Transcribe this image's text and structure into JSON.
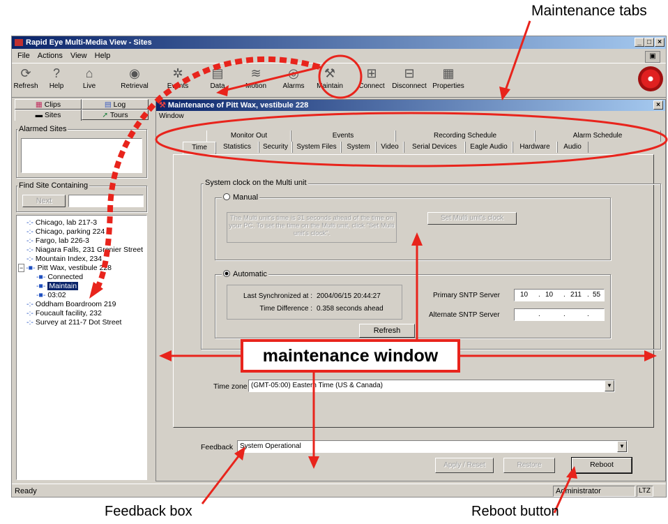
{
  "window": {
    "title": "Rapid Eye Multi-Media View - Sites",
    "controls": [
      "_",
      "□",
      "×"
    ]
  },
  "menu": {
    "items": [
      "File",
      "Actions",
      "View",
      "Help"
    ]
  },
  "toolbar": {
    "buttons": [
      {
        "label": "Refresh",
        "icon": "refresh-icon"
      },
      {
        "label": "Help",
        "icon": "help-icon"
      },
      {
        "label": "Live",
        "icon": "live-camera-icon"
      },
      {
        "label": "Retrieval",
        "icon": "retrieval-icon"
      },
      {
        "label": "Events",
        "icon": "events-icon"
      },
      {
        "label": "Data",
        "icon": "data-icon"
      },
      {
        "label": "Motion",
        "icon": "motion-icon"
      },
      {
        "label": "Alarms",
        "icon": "alarms-icon"
      },
      {
        "label": "Maintain",
        "icon": "maintain-icon"
      },
      {
        "label": "Connect",
        "icon": "connect-icon"
      },
      {
        "label": "Disconnect",
        "icon": "disconnect-icon"
      },
      {
        "label": "Properties",
        "icon": "properties-icon"
      }
    ]
  },
  "sidebar": {
    "tabs_top": [
      "Clips",
      "Log"
    ],
    "tabs_bottom": [
      "Sites",
      "Tours"
    ],
    "alarmed_label": "Alarmed Sites",
    "find_label": "Find Site Containing",
    "next_label": "Next",
    "tree": [
      "Chicago, lab 217-3",
      "Chicago, parking 224",
      "Fargo, lab 226-3",
      "Niagara Falls, 231 Grenier Street",
      "Mountain Index, 234",
      "Pitt Wax, vestibule 228",
      "Connected",
      "Maintain",
      "03:02",
      "Oddham Boardroom 219",
      "Foucault facility, 232",
      "Survey at 211-7 Dot Street"
    ]
  },
  "maintenance": {
    "title": "Maintenance of Pitt Wax, vestibule 228",
    "menu": "Window",
    "close": "×",
    "tabs_back": [
      "Monitor Out",
      "Events",
      "Recording Schedule",
      "Alarm Schedule"
    ],
    "tabs_front": [
      "Time",
      "Statistics",
      "Security",
      "System Files",
      "System",
      "Video",
      "Serial Devices",
      "Eagle Audio",
      "Hardware",
      "Audio"
    ],
    "clock_group": "System clock on the Multi unit",
    "manual_label": "Manual",
    "manual_text": "The Multi unit's time is 31 seconds ahead of the time on your PC. To set the time on the Multi unit, click \"Set Multi unit's clock\".",
    "set_clock_btn": "Set Multi unit's clock",
    "automatic_label": "Automatic",
    "last_sync_label": "Last Synchronized at :",
    "last_sync_value": "2004/06/15  20:44:27",
    "time_diff_label": "Time Difference :",
    "time_diff_value": "0.358 seconds ahead",
    "refresh_btn": "Refresh",
    "primary_sntp_label": "Primary SNTP Server",
    "primary_ip": [
      "10",
      "10",
      "211",
      "55"
    ],
    "alternate_sntp_label": "Alternate SNTP Server",
    "alternate_ip": [
      "",
      "",
      "",
      ""
    ],
    "timezone_label": "Time zone",
    "timezone_value": "(GMT-05:00) Eastern Time (US & Canada)",
    "feedback_label": "Feedback",
    "feedback_value": "System Operational",
    "apply_btn": "Apply / Reset",
    "restore_btn": "Restore",
    "reboot_btn": "Reboot"
  },
  "statusbar": {
    "status": "Ready",
    "user": "Administrator",
    "tz": "LTZ"
  },
  "annotations": {
    "maintenance_tabs": "Maintenance tabs",
    "maintenance_window": "maintenance window",
    "feedback_box": "Feedback box",
    "reboot_button": "Reboot button"
  },
  "colors": {
    "annotation_red": "#e8241c",
    "title_blue": "#0a246a",
    "selection_blue": "#0a246a"
  }
}
